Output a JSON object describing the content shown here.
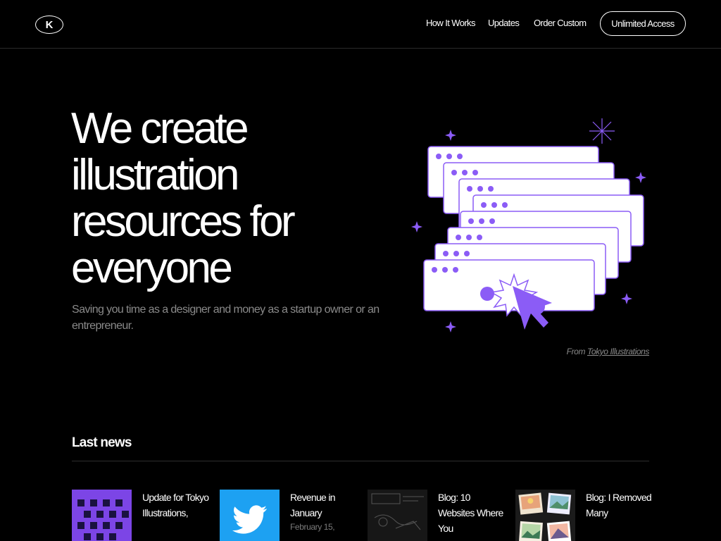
{
  "nav": {
    "logo_letter": "K",
    "links": [
      "How It Works",
      "Updates",
      "Order Custom"
    ],
    "cta": "Unlimited Access"
  },
  "hero": {
    "title_lines": [
      "We create",
      "illustration",
      "resources for",
      "everyone"
    ],
    "subtitle": "Saving you time as a designer and money as a startup owner or an entrepreneur.",
    "credit_prefix": "From",
    "credit_link": "Tokyo Illustrations"
  },
  "news": {
    "heading": "Last news",
    "items": [
      {
        "title": "Update for Tokyo Illustrations,",
        "date": "",
        "thumb": "purple-pattern"
      },
      {
        "title": "Revenue in January",
        "date": "February 15,",
        "thumb": "twitter-bird-icon"
      },
      {
        "title": "Blog: 10 Websites Where You",
        "date": "",
        "thumb": "sketch-dark"
      },
      {
        "title": "Blog: I Removed Many",
        "date": "",
        "thumb": "photo-collage"
      }
    ]
  },
  "colors": {
    "background": "#000000",
    "accent": "#8b5cf6",
    "twitter": "#1da1f2"
  }
}
